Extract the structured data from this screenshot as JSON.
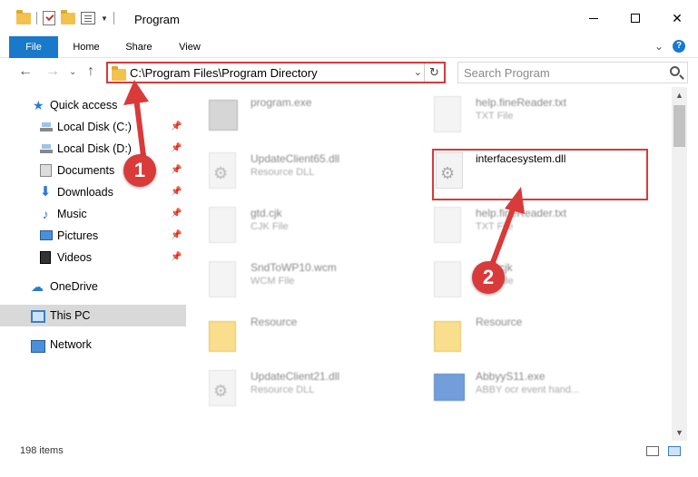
{
  "window": {
    "title": "Program"
  },
  "ribbon": {
    "tabs": [
      {
        "label": "File"
      },
      {
        "label": "Home"
      },
      {
        "label": "Share"
      },
      {
        "label": "View"
      }
    ]
  },
  "address": {
    "path": "C:\\Program Files\\Program Directory",
    "search_placeholder": "Search Program"
  },
  "nav": {
    "items": [
      {
        "label": "Quick access",
        "icon": "star-icon",
        "pinned": false
      },
      {
        "label": "Local Disk (C:)",
        "icon": "disk-icon",
        "pinned": true
      },
      {
        "label": "Local Disk (D:)",
        "icon": "disk-icon",
        "pinned": true
      },
      {
        "label": "Documents",
        "icon": "documents-icon",
        "pinned": true
      },
      {
        "label": "Downloads",
        "icon": "download-icon",
        "pinned": true
      },
      {
        "label": "Music",
        "icon": "music-icon",
        "pinned": true
      },
      {
        "label": "Pictures",
        "icon": "pictures-icon",
        "pinned": true
      },
      {
        "label": "Videos",
        "icon": "videos-icon",
        "pinned": true
      },
      {
        "label": "OneDrive",
        "icon": "cloud-icon",
        "pinned": false
      },
      {
        "label": "This PC",
        "icon": "computer-icon",
        "pinned": false,
        "selected": true
      },
      {
        "label": "Network",
        "icon": "network-icon",
        "pinned": false
      }
    ]
  },
  "files": [
    {
      "name": "program.exe",
      "sub": "",
      "icon": "exe-icon"
    },
    {
      "name": "help.fineReader.txt",
      "sub": "TXT File",
      "icon": "text-file-icon"
    },
    {
      "name": "UpdateClient65.dll",
      "sub": "Resource DLL",
      "icon": "dll-icon"
    },
    {
      "name": "interfacesystem.dll",
      "sub": "",
      "icon": "dll-icon"
    },
    {
      "name": "gtd.cjk",
      "sub": "CJK File",
      "icon": "file-icon"
    },
    {
      "name": "help.fineReader.txt",
      "sub": "TXT File",
      "icon": "text-file-icon"
    },
    {
      "name": "SndToWP10.wcm",
      "sub": "WCM File",
      "icon": "file-icon"
    },
    {
      "name": "com.cjk",
      "sub": "CJK File",
      "icon": "file-icon"
    },
    {
      "name": "Resource",
      "sub": "",
      "icon": "folder-icon"
    },
    {
      "name": "Resource",
      "sub": "",
      "icon": "folder-icon"
    },
    {
      "name": "UpdateClient21.dll",
      "sub": "Resource DLL",
      "icon": "dll-icon"
    },
    {
      "name": "AbbyyS11.exe",
      "sub": "ABBY ocr event hand...",
      "icon": "app-icon"
    }
  ],
  "annotations": {
    "step1": "1",
    "step2": "2"
  },
  "status": {
    "item_count": "198 items"
  },
  "colors": {
    "accent": "#1979ca",
    "annotation_red": "#d93a3a"
  }
}
